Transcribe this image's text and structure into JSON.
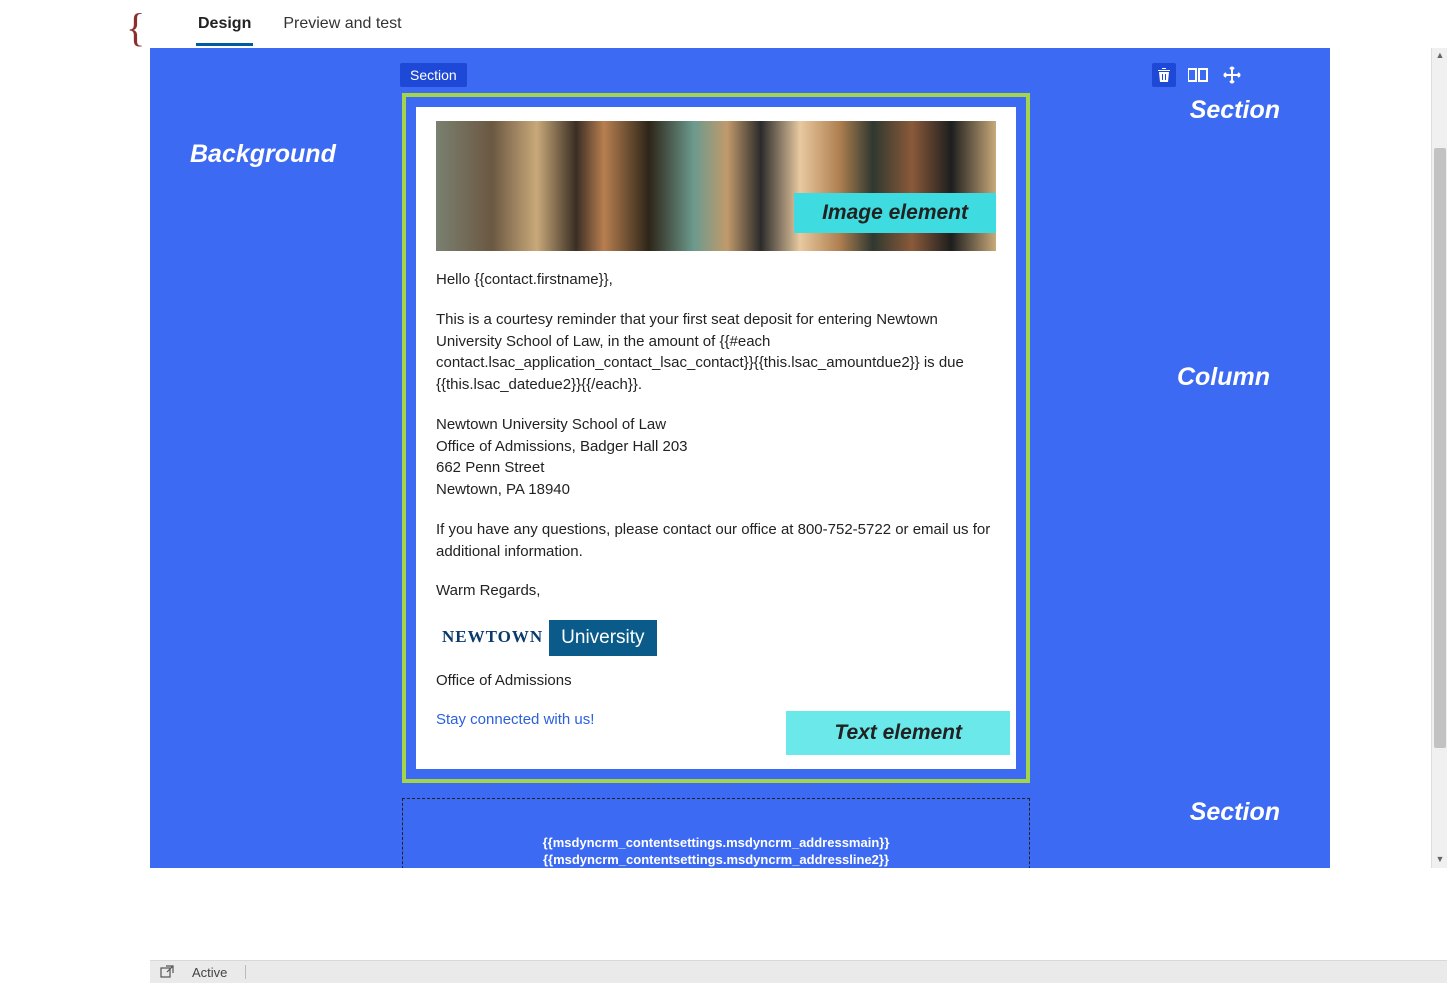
{
  "tabs": {
    "design": "Design",
    "preview": "Preview and test"
  },
  "section_label": "Section",
  "annotations": {
    "background": "Background",
    "section_top": "Section",
    "column": "Column",
    "section_bottom": "Section",
    "image_element": "Image element",
    "text_element": "Text element"
  },
  "email": {
    "greeting": "Hello {{contact.firstname}},",
    "body_p1": "This is a courtesy reminder that your first seat deposit for entering Newtown University School of Law, in the amount of {{#each contact.lsac_application_contact_lsac_contact}}{{this.lsac_amountdue2}} is due {{this.lsac_datedue2}}{{/each}}.",
    "addr_line1": "Newtown University School of Law",
    "addr_line2": "Office of Admissions, Badger Hall 203",
    "addr_line3": "662 Penn Street",
    "addr_line4": "Newtown, PA  18940",
    "body_p2": "If you have any questions, please contact our office at 800-752-5722 or email us for additional information.",
    "closing": "Warm Regards,",
    "logo_left": "NEWTOWN",
    "logo_right": "University",
    "office": "Office of Admissions",
    "link": "Stay connected with us!"
  },
  "footer_tokens": {
    "line1": "{{msdyncrm_contentsettings.msdyncrm_addressmain}}",
    "line2": "{{msdyncrm_contentsettings.msdyncrm_addressline2}}"
  },
  "status": {
    "active": "Active"
  },
  "icons": {
    "trash": "trash-icon",
    "columns": "columns-icon",
    "move": "move-icon",
    "popout": "popout-icon"
  }
}
